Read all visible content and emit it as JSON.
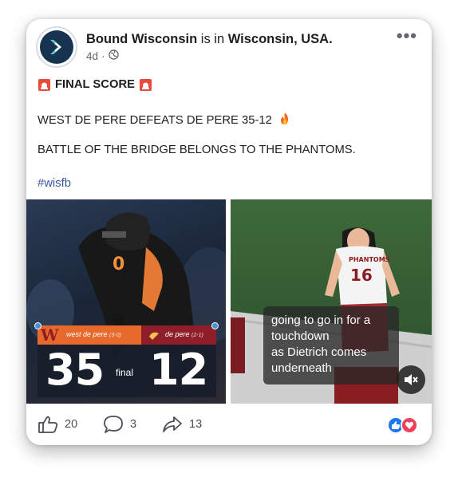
{
  "post": {
    "author": "Bound Wisconsin",
    "is_in": "is in",
    "location": "Wisconsin, USA.",
    "time": "4d",
    "separator": "·",
    "final_score_label": "FINAL SCORE",
    "line1": "WEST DE PERE DEFEATS DE PERE 35-12",
    "line2": "BATTLE OF THE BRIDGE BELONGS TO THE PHANTOMS.",
    "hashtag": "#wisfb"
  },
  "scoreboard": {
    "home_team": "west de pere",
    "home_record": "(3-0)",
    "home_score": "35",
    "away_team": "de pere",
    "away_record": "(2-1)",
    "away_score": "12",
    "status": "final",
    "home_color": "#e8692c",
    "away_color": "#8e1f28"
  },
  "video": {
    "caption_line1": "going to go in for a",
    "caption_line2": "touchdown",
    "caption_line3": "as Dietrich comes",
    "caption_line4": "underneath",
    "jersey_number": "16",
    "jersey_text": "PHANTOMS",
    "player_number_left": "0"
  },
  "footer": {
    "likes": "20",
    "comments": "3",
    "shares": "13"
  },
  "icons": [
    "globe-icon",
    "siren-icon",
    "fire-icon",
    "like-icon",
    "comment-icon",
    "share-icon",
    "mute-icon",
    "like-reaction-icon",
    "love-reaction-icon",
    "more-icon"
  ]
}
